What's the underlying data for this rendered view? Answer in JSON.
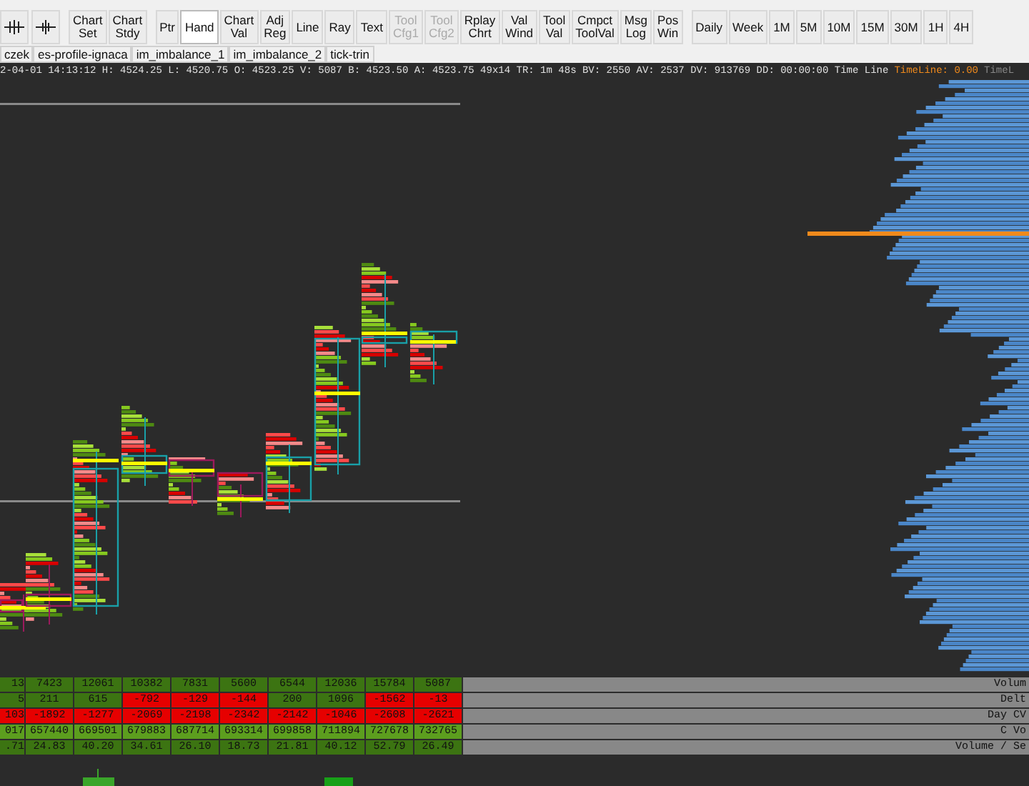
{
  "toolbar": {
    "groups": [
      [
        {
          "label": "Chart\nSet",
          "selected": false,
          "disabled": false
        },
        {
          "label": "Chart\nStdy",
          "selected": false,
          "disabled": false
        }
      ],
      [
        {
          "label": "Ptr",
          "selected": false,
          "disabled": false
        },
        {
          "label": "Hand",
          "selected": true,
          "disabled": false
        },
        {
          "label": "Chart\nVal",
          "selected": false,
          "disabled": false
        },
        {
          "label": "Adj\nReg",
          "selected": false,
          "disabled": false
        },
        {
          "label": "Line",
          "selected": false,
          "disabled": false
        },
        {
          "label": "Ray",
          "selected": false,
          "disabled": false
        },
        {
          "label": "Text",
          "selected": false,
          "disabled": false
        },
        {
          "label": "Tool\nCfg1",
          "selected": false,
          "disabled": true
        },
        {
          "label": "Tool\nCfg2",
          "selected": false,
          "disabled": true
        },
        {
          "label": "Rplay\nChrt",
          "selected": false,
          "disabled": false
        },
        {
          "label": "Val\nWind",
          "selected": false,
          "disabled": false
        },
        {
          "label": "Tool\nVal",
          "selected": false,
          "disabled": false
        },
        {
          "label": "Cmpct\nToolVal",
          "selected": false,
          "disabled": false
        },
        {
          "label": "Msg\nLog",
          "selected": false,
          "disabled": false
        },
        {
          "label": "Pos\nWin",
          "selected": false,
          "disabled": false
        }
      ],
      [
        {
          "label": "Daily",
          "selected": false,
          "disabled": false
        },
        {
          "label": "Week",
          "selected": false,
          "disabled": false
        },
        {
          "label": "1M",
          "selected": false,
          "disabled": false
        },
        {
          "label": "5M",
          "selected": false,
          "disabled": false
        },
        {
          "label": "10M",
          "selected": false,
          "disabled": false
        },
        {
          "label": "15M",
          "selected": false,
          "disabled": false
        },
        {
          "label": "30M",
          "selected": false,
          "disabled": false
        },
        {
          "label": "1H",
          "selected": false,
          "disabled": false
        },
        {
          "label": "4H",
          "selected": false,
          "disabled": false
        }
      ]
    ]
  },
  "tabs": [
    {
      "label": "czek",
      "selected": false
    },
    {
      "label": "es-profile-ignaca",
      "selected": false
    },
    {
      "label": "im_imbalance_1",
      "selected": false
    },
    {
      "label": "im_imbalance_2",
      "selected": false
    },
    {
      "label": "tick-trin",
      "selected": false
    }
  ],
  "status_bar": {
    "text": "2-04-01 14:13:12 H: 4524.25 L: 4520.75 O: 4523.25 V: 5087 B: 4523.50 A: 4523.75 49x14 TR: 1m 48s BV: 2550 AV: 2537 DV: 913769 DD: 00:00:00 Time Line",
    "timeline": "TimeLine: 0.00",
    "timeline_cut": "TimeL"
  },
  "table": {
    "rows": [
      {
        "label": "Volum",
        "cells": [
          {
            "text": "13",
            "color": "#3c7412"
          },
          {
            "text": "7423",
            "color": "#3c7412"
          },
          {
            "text": "12061",
            "color": "#3c7412"
          },
          {
            "text": "10382",
            "color": "#3c7412"
          },
          {
            "text": "7831",
            "color": "#3c7412"
          },
          {
            "text": "5600",
            "color": "#3c7412"
          },
          {
            "text": "6544",
            "color": "#3c7412"
          },
          {
            "text": "12036",
            "color": "#3c7412"
          },
          {
            "text": "15784",
            "color": "#3c7412"
          },
          {
            "text": "5087",
            "color": "#3c7412"
          }
        ]
      },
      {
        "label": "Delt",
        "cells": [
          {
            "text": "5",
            "color": "#3c7412"
          },
          {
            "text": "211",
            "color": "#3c7412"
          },
          {
            "text": "615",
            "color": "#3c7412"
          },
          {
            "text": "-792",
            "color": "#e60000"
          },
          {
            "text": "-129",
            "color": "#e60000"
          },
          {
            "text": "-144",
            "color": "#e60000"
          },
          {
            "text": "200",
            "color": "#3c7412"
          },
          {
            "text": "1096",
            "color": "#3c7412"
          },
          {
            "text": "-1562",
            "color": "#e60000"
          },
          {
            "text": "-13",
            "color": "#e60000"
          }
        ]
      },
      {
        "label": "Day CV",
        "cells": [
          {
            "text": "103",
            "color": "#e60000"
          },
          {
            "text": "-1892",
            "color": "#e60000"
          },
          {
            "text": "-1277",
            "color": "#e60000"
          },
          {
            "text": "-2069",
            "color": "#e60000"
          },
          {
            "text": "-2198",
            "color": "#e60000"
          },
          {
            "text": "-2342",
            "color": "#e60000"
          },
          {
            "text": "-2142",
            "color": "#e60000"
          },
          {
            "text": "-1046",
            "color": "#e60000"
          },
          {
            "text": "-2608",
            "color": "#e60000"
          },
          {
            "text": "-2621",
            "color": "#e60000"
          }
        ]
      },
      {
        "label": "C Vo",
        "cells": [
          {
            "text": "017",
            "color": "#5c9e1e"
          },
          {
            "text": "657440",
            "color": "#5c9e1e"
          },
          {
            "text": "669501",
            "color": "#5c9e1e"
          },
          {
            "text": "679883",
            "color": "#5c9e1e"
          },
          {
            "text": "687714",
            "color": "#5c9e1e"
          },
          {
            "text": "693314",
            "color": "#5c9e1e"
          },
          {
            "text": "699858",
            "color": "#5c9e1e"
          },
          {
            "text": "711894",
            "color": "#5c9e1e"
          },
          {
            "text": "727678",
            "color": "#5c9e1e"
          },
          {
            "text": "732765",
            "color": "#5c9e1e"
          }
        ]
      },
      {
        "label": "Volume / Se",
        "cells": [
          {
            "text": ".71",
            "color": "#3c7412"
          },
          {
            "text": "24.83",
            "color": "#3c7412"
          },
          {
            "text": "40.20",
            "color": "#3c7412"
          },
          {
            "text": "34.61",
            "color": "#3c7412"
          },
          {
            "text": "26.10",
            "color": "#3c7412"
          },
          {
            "text": "18.73",
            "color": "#3c7412"
          },
          {
            "text": "21.81",
            "color": "#3c7412"
          },
          {
            "text": "40.12",
            "color": "#3c7412"
          },
          {
            "text": "52.79",
            "color": "#3c7412"
          },
          {
            "text": "26.49",
            "color": "#3c7412"
          }
        ]
      }
    ]
  }
}
